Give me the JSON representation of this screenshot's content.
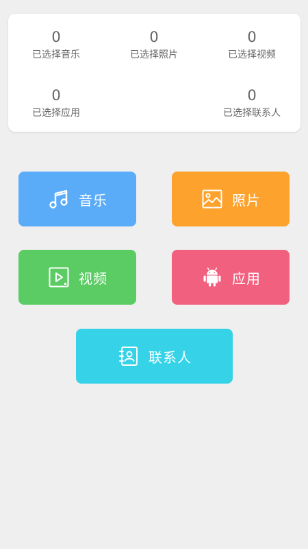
{
  "summary": {
    "music": {
      "count": "0",
      "label": "已选择音乐"
    },
    "photos": {
      "count": "0",
      "label": "已选择照片"
    },
    "videos": {
      "count": "0",
      "label": "已选择视频"
    },
    "apps": {
      "count": "0",
      "label": "已选择应用"
    },
    "contacts": {
      "count": "0",
      "label": "已选择联系人"
    }
  },
  "categories": {
    "music": {
      "label": "音乐",
      "icon": "music-note-icon",
      "color": "#5aabf8"
    },
    "photos": {
      "label": "照片",
      "icon": "image-icon",
      "color": "#fda22c"
    },
    "videos": {
      "label": "视频",
      "icon": "video-play-icon",
      "color": "#5bcc63"
    },
    "apps": {
      "label": "应用",
      "icon": "android-icon",
      "color": "#f2607f"
    },
    "contacts": {
      "label": "联系人",
      "icon": "contact-book-icon",
      "color": "#36d3e8"
    }
  }
}
